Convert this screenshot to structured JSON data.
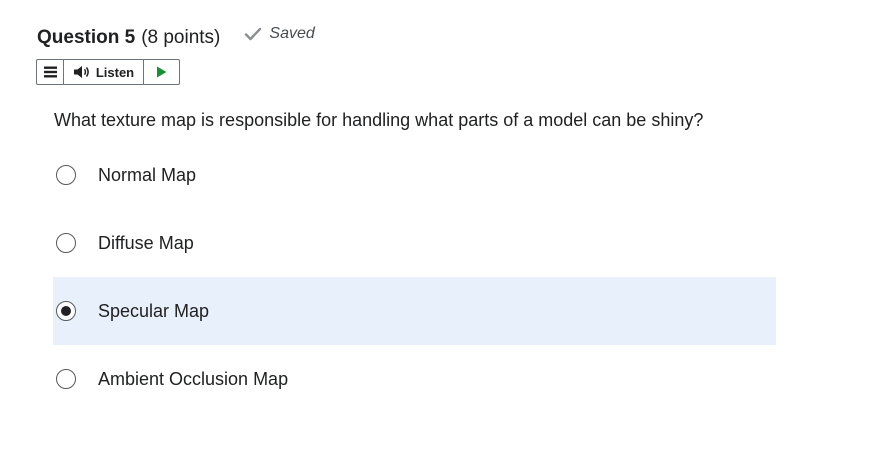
{
  "question": {
    "title": "Question 5",
    "points": "(8 points)",
    "saved_label": "Saved",
    "text": "What texture map is responsible for handling what parts of a model can be shiny?"
  },
  "toolbar": {
    "listen_label": "Listen"
  },
  "options": [
    {
      "label": "Normal Map",
      "selected": false
    },
    {
      "label": "Diffuse Map",
      "selected": false
    },
    {
      "label": "Specular Map",
      "selected": true
    },
    {
      "label": "Ambient Occlusion Map",
      "selected": false
    }
  ],
  "icons": {
    "saved": "checkmark-icon",
    "menu": "hamburger-menu-icon",
    "speaker": "speaker-icon",
    "play": "play-icon"
  },
  "colors": {
    "selected_background": "#e8f1fb",
    "play_green": "#1b8e3a",
    "text": "#202122"
  }
}
